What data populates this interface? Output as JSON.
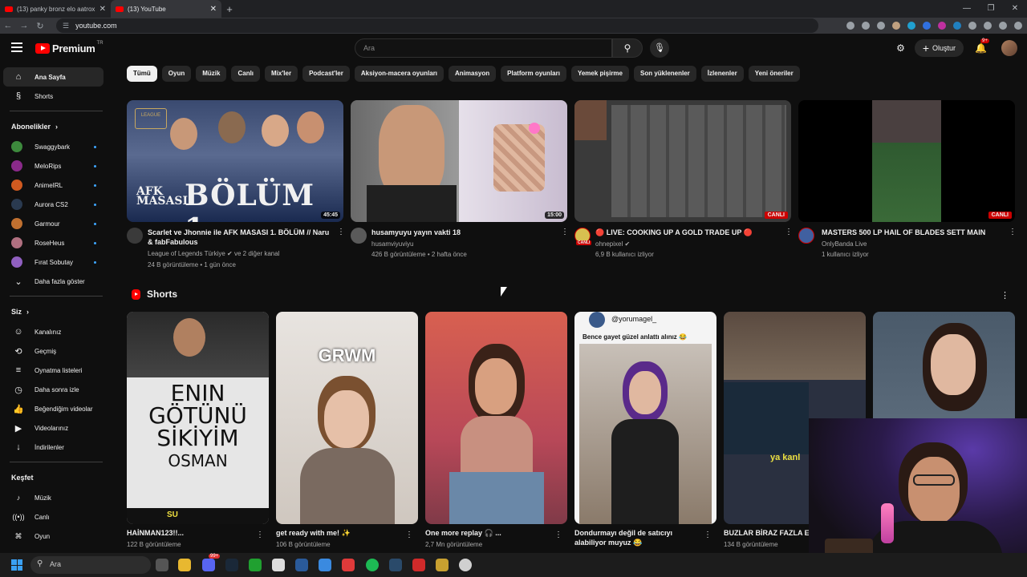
{
  "browser": {
    "tabs": [
      {
        "title": "(13) panky bronz elo aatrox - Y"
      },
      {
        "title": "(13) YouTube"
      }
    ],
    "url": "youtube.com"
  },
  "header": {
    "logo": "Premium",
    "region": "TR",
    "search_placeholder": "Ara",
    "create_label": "Oluştur",
    "notification_count": "9+"
  },
  "sidebar": {
    "home": "Ana Sayfa",
    "shorts": "Shorts",
    "subs_title": "Abonelikler",
    "subscriptions": [
      {
        "name": "Swaggybark",
        "color": "#3d8a3d"
      },
      {
        "name": "MeloRips",
        "color": "#8a2a8a"
      },
      {
        "name": "AnimeIRL",
        "color": "#d05a20"
      },
      {
        "name": "Aurora CS2",
        "color": "#2a3a50"
      },
      {
        "name": "Garmour",
        "color": "#c07030"
      },
      {
        "name": "RoseHeus",
        "color": "#b07080"
      },
      {
        "name": "Fırat Sobutay",
        "color": "#9060c0"
      }
    ],
    "show_more": "Daha fazla göster",
    "you_title": "Siz",
    "you_items": [
      "Kanalınız",
      "Geçmiş",
      "Oynatma listeleri",
      "Daha sonra izle",
      "Beğendiğim videolar",
      "Videolarınız",
      "İndirilenler"
    ],
    "explore_title": "Keşfet",
    "explore_items": [
      "Müzik",
      "Canlı",
      "Oyun",
      "Daha fazla göster"
    ]
  },
  "chips": [
    "Tümü",
    "Oyun",
    "Müzik",
    "Canlı",
    "Mix'ler",
    "Podcast'ler",
    "Aksiyon-macera oyunları",
    "Animasyon",
    "Platform oyunları",
    "Yemek pişirme",
    "Son yüklenenler",
    "İzlenenler",
    "Yeni öneriler"
  ],
  "videos": [
    {
      "title": "Scarlet ve Jhonnie ile AFK MASASI 1. BÖLÜM // Naru & fabFabulous",
      "channel": "League of Legends Türkiye",
      "channel_extra": "ve 2 diğer kanal",
      "meta": "24 B görüntüleme • 1 gün önce",
      "duration": "45:45",
      "thumb_text_small": "AFK\nMASASI",
      "thumb_text_big": "BÖLÜM 1"
    },
    {
      "title": "husamyuyu yayın vakti 18",
      "channel": "husamviyuviyu",
      "meta": "426 B görüntüleme • 2 hafta önce",
      "duration": "15:00"
    },
    {
      "title": "🔴 LIVE: COOKING UP A GOLD TRADE UP 🔴",
      "channel": "ohnepixel",
      "meta": "6,9 B kullanıcı izliyor",
      "live": "CANLI",
      "avatar_live": "CANLI"
    },
    {
      "title": "MASTERS 500 LP HAIL OF BLADES SETT MAIN",
      "channel": "OnlyBanda Live",
      "meta": "1 kullanıcı izliyor",
      "live": "CANLI"
    }
  ],
  "shorts_title": "Shorts",
  "shorts": [
    {
      "title": "HAİNMAN123!!...",
      "views": "122 B görüntüleme",
      "sign_lines": [
        "ENIN",
        "GÖTÜNÜ",
        "SİKİYİM",
        "OSMAN"
      ],
      "caption": "SU"
    },
    {
      "title": "get ready with me! ✨",
      "views": "106 B görüntüleme",
      "overlay": "GRWM"
    },
    {
      "title": "One more replay 🎧 ...",
      "views": "2,7 Mn görüntüleme"
    },
    {
      "title": "Dondurmayı değil de satıcıyı alabiliyor muyuz 😂",
      "views": "",
      "handle": "@yorumagel_",
      "overlay": "Bence gayet güzel anlattı alınız 😂"
    },
    {
      "title": "BUZLAR BİRAZ FAZLA Eİ",
      "views": "134 B görüntüleme",
      "overlay": "ya kanl"
    },
    {
      "title": "",
      "views": ""
    }
  ],
  "taskbar": {
    "search": "Ara",
    "badge": "99+"
  }
}
